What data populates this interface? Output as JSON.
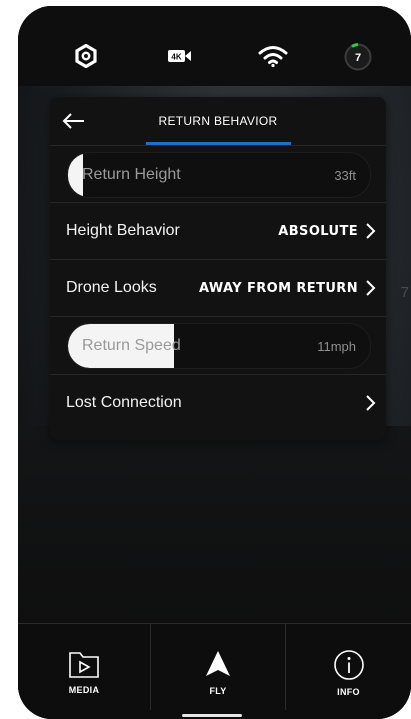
{
  "status_bar": {
    "resolution_badge": "4K",
    "satellite_count": "7",
    "icons": [
      "settings-icon",
      "camera-4k-icon",
      "wifi-icon",
      "satellite-icon"
    ]
  },
  "panel": {
    "title": "RETURN BEHAVIOR",
    "accent_color": "#1f6fc8",
    "rows": {
      "return_height": {
        "label": "Return Height",
        "value": "33ft",
        "level": 0.05
      },
      "height_behavior": {
        "label": "Height Behavior",
        "value": "ABSOLUTE"
      },
      "drone_looks": {
        "label": "Drone Looks",
        "value": "AWAY FROM RETURN"
      },
      "return_speed": {
        "label": "Return Speed",
        "value": "11mph",
        "level": 0.35
      },
      "lost_connection": {
        "label": "Lost Connection"
      }
    }
  },
  "background_text": {
    "right_edge_digit": "7"
  },
  "bottom_nav": {
    "media": "MEDIA",
    "fly": "FLY",
    "info": "INFO"
  }
}
